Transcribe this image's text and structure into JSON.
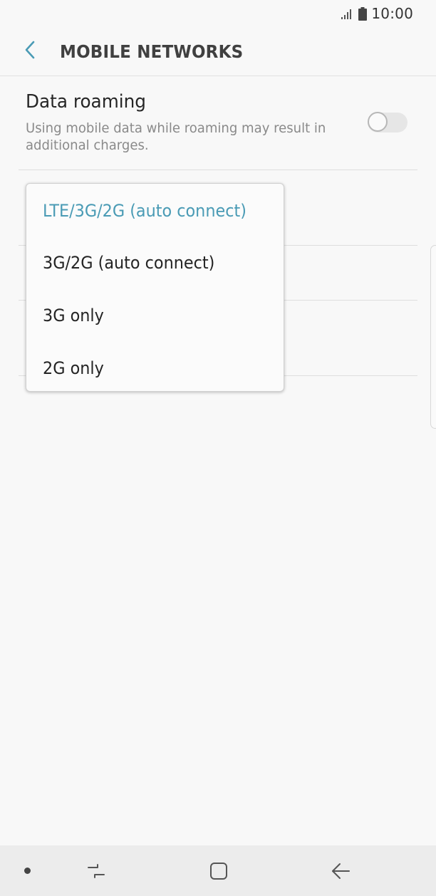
{
  "status_bar": {
    "time": "10:00",
    "icons": [
      "signal-icon",
      "battery-icon"
    ]
  },
  "header": {
    "title": "MOBILE NETWORKS",
    "back_icon": "chevron-left-icon"
  },
  "data_roaming": {
    "title": "Data roaming",
    "description": "Using mobile data while roaming may result in additional charges.",
    "enabled": false
  },
  "network_mode_menu": {
    "options": [
      {
        "label": "LTE/3G/2G (auto connect)",
        "selected": true
      },
      {
        "label": "3G/2G (auto connect)",
        "selected": false
      },
      {
        "label": "3G only",
        "selected": false
      },
      {
        "label": "2G only",
        "selected": false
      }
    ]
  },
  "navigation_bar": {
    "buttons": [
      "recent-apps-icon",
      "home-icon",
      "back-arrow-icon"
    ]
  },
  "colors": {
    "accent": "#4a9bb5",
    "background": "#f8f8f8",
    "nav_bar": "#ececec"
  }
}
